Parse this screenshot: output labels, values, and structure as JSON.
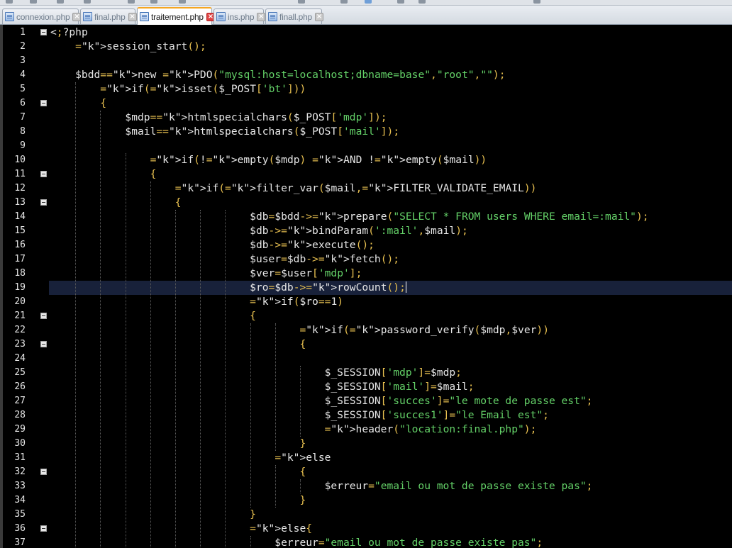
{
  "tabs": [
    {
      "label": "connexion.php",
      "active": false
    },
    {
      "label": "final.php",
      "active": false
    },
    {
      "label": "traitement.php",
      "active": true
    },
    {
      "label": "ins.php",
      "active": false
    },
    {
      "label": "finall.php",
      "active": false
    }
  ],
  "editor": {
    "current_line": 19,
    "lines": [
      {
        "n": "1",
        "code": "<?php",
        "fold": true
      },
      {
        "n": "2",
        "code": "    session_start();",
        "fold": false
      },
      {
        "n": "3",
        "code": "",
        "fold": false
      },
      {
        "n": "4",
        "code": "    $bdd=new PDO(\"mysql:host=localhost;dbname=base\",\"root\",\"\");",
        "fold": false
      },
      {
        "n": "5",
        "code": "        if(isset($_POST['bt']))",
        "fold": false
      },
      {
        "n": "6",
        "code": "        {",
        "fold": true
      },
      {
        "n": "7",
        "code": "            $mdp=htmlspecialchars($_POST['mdp']);",
        "fold": false
      },
      {
        "n": "8",
        "code": "            $mail=htmlspecialchars($_POST['mail']);",
        "fold": false
      },
      {
        "n": "9",
        "code": "",
        "fold": false
      },
      {
        "n": "10",
        "code": "                if(!empty($mdp) AND !empty($mail))",
        "fold": false
      },
      {
        "n": "11",
        "code": "                {",
        "fold": true
      },
      {
        "n": "12",
        "code": "                    if(filter_var($mail,FILTER_VALIDATE_EMAIL))",
        "fold": false
      },
      {
        "n": "13",
        "code": "                    {",
        "fold": true
      },
      {
        "n": "14",
        "code": "                                $db=$bdd->prepare(\"SELECT * FROM users WHERE email=:mail\");",
        "fold": false
      },
      {
        "n": "15",
        "code": "                                $db->bindParam(':mail',$mail);",
        "fold": false
      },
      {
        "n": "16",
        "code": "                                $db->execute();",
        "fold": false
      },
      {
        "n": "17",
        "code": "                                $user=$db->fetch();",
        "fold": false
      },
      {
        "n": "18",
        "code": "                                $ver=$user['mdp'];",
        "fold": false
      },
      {
        "n": "19",
        "code": "                                $ro=$db->rowCount();",
        "fold": false
      },
      {
        "n": "20",
        "code": "                                if($ro==1)",
        "fold": false
      },
      {
        "n": "21",
        "code": "                                {",
        "fold": true
      },
      {
        "n": "22",
        "code": "                                        if(password_verify($mdp,$ver))",
        "fold": false
      },
      {
        "n": "23",
        "code": "                                        {",
        "fold": true
      },
      {
        "n": "24",
        "code": "",
        "fold": false
      },
      {
        "n": "25",
        "code": "                                            $_SESSION['mdp']=$mdp;",
        "fold": false
      },
      {
        "n": "26",
        "code": "                                            $_SESSION['mail']=$mail;",
        "fold": false
      },
      {
        "n": "27",
        "code": "                                            $_SESSION['succes']=\"le mote de passe est\";",
        "fold": false
      },
      {
        "n": "28",
        "code": "                                            $_SESSION['succes1']=\"le Email est\";",
        "fold": false
      },
      {
        "n": "29",
        "code": "                                            header(\"location:final.php\");",
        "fold": false
      },
      {
        "n": "30",
        "code": "                                        }",
        "fold": false
      },
      {
        "n": "31",
        "code": "                                    else",
        "fold": false
      },
      {
        "n": "32",
        "code": "                                        {",
        "fold": true
      },
      {
        "n": "33",
        "code": "                                            $erreur=\"email ou mot de passe existe pas\";",
        "fold": false
      },
      {
        "n": "34",
        "code": "                                        }",
        "fold": false
      },
      {
        "n": "35",
        "code": "                                }",
        "fold": false
      },
      {
        "n": "36",
        "code": "                                else{",
        "fold": true
      },
      {
        "n": "37",
        "code": "                                    $erreur=\"email ou mot de passe existe pas\";",
        "fold": false
      }
    ]
  },
  "colors": {
    "background": "#000000",
    "keyword": "#f0c674",
    "string": "#64d168",
    "current_line": "#18213a",
    "active_tab_accent": "#f5a623"
  }
}
